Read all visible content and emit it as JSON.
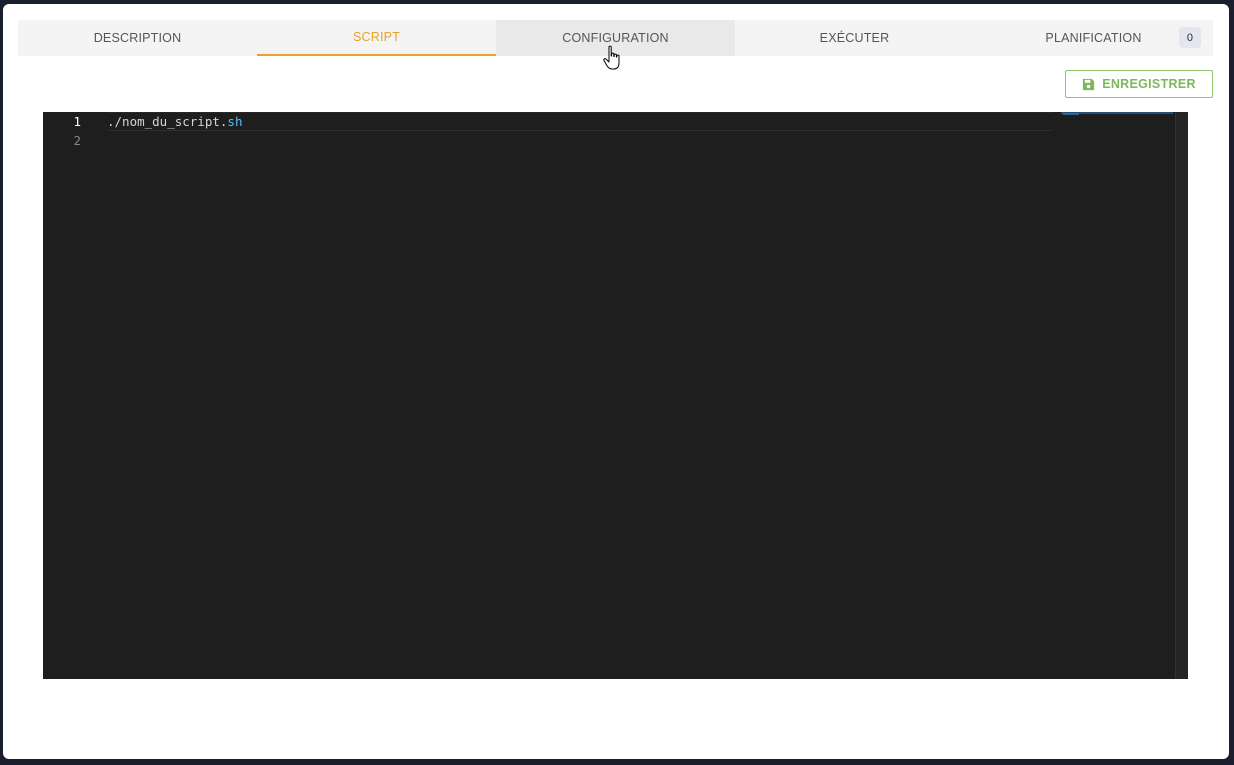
{
  "tabs": [
    {
      "label": "DESCRIPTION",
      "state": "normal"
    },
    {
      "label": "SCRIPT",
      "state": "active"
    },
    {
      "label": "CONFIGURATION",
      "state": "hover"
    },
    {
      "label": "EXÉCUTER",
      "state": "normal"
    },
    {
      "label": "PLANIFICATION",
      "state": "normal",
      "badge": "0"
    }
  ],
  "toolbar": {
    "save_label": "ENREGISTRER",
    "save_icon": "floppy-disk-icon",
    "save_color": "#7cb85a"
  },
  "editor": {
    "theme_background": "#1e1e1e",
    "line_numbers": [
      "1",
      "2"
    ],
    "lines": [
      {
        "text": "./nom_du_script.",
        "ext": "sh"
      },
      {
        "text": "",
        "ext": ""
      }
    ]
  },
  "colors": {
    "active_tab": "#e8a32a",
    "save_button": "#7cb85a"
  }
}
